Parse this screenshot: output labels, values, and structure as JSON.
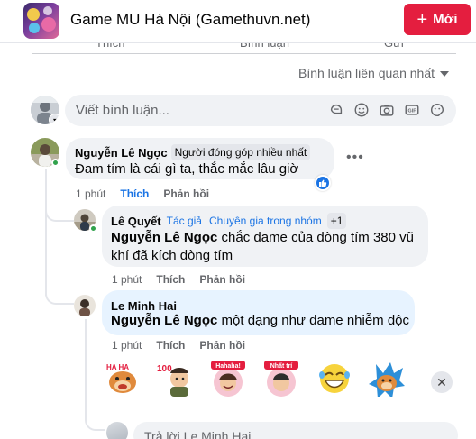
{
  "header": {
    "group_title": "Game MU Hà Nội (Gamethuvn.net)",
    "new_button_label": "Mới",
    "new_button_icon": "plus-icon",
    "accent_color": "#e41e3f"
  },
  "post_actions": {
    "like_label": "Thích",
    "comment_label": "Bình luận",
    "share_label": "Gửi"
  },
  "sort": {
    "label": "Bình luận liên quan nhất"
  },
  "composer": {
    "placeholder": "Viết bình luận...",
    "icons": [
      "avatar-sticker-icon",
      "emoji-icon",
      "camera-icon",
      "gif-icon",
      "sticker-icon"
    ]
  },
  "comments": [
    {
      "author": "Nguyễn Lê Ngọc",
      "badge": "Người đóng góp nhiều nhất",
      "text": "Đam tím là cái gì ta, thắc mắc lâu giờ",
      "time": "1 phút",
      "like_label": "Thích",
      "reply_label": "Phản hồi",
      "reaction": "like"
    }
  ],
  "replies": [
    {
      "author": "Lê Quyết",
      "tag_author": "Tác giả",
      "tag_expert": "Chuyên gia trong nhóm",
      "extra_badges": "+1",
      "mention": "Nguyễn Lê Ngọc",
      "text": " chắc dame của dòng tím 380 vũ khí đã kích dòng tím",
      "time": "1 phút",
      "like_label": "Thích",
      "reply_label": "Phản hồi"
    },
    {
      "author": "Le Minh Hai",
      "mention": "Nguyễn Lê Ngọc",
      "text": " một dạng như dame nhiễm độc",
      "time": "1 phút",
      "like_label": "Thích",
      "reply_label": "Phản hồi"
    }
  ],
  "stickers": {
    "items": [
      {
        "name": "haha-dog-sticker",
        "label": "HA HA"
      },
      {
        "name": "hundred-man-sticker",
        "label": "100"
      },
      {
        "name": "hahaha-woman-sticker",
        "label": "Hahaha!"
      },
      {
        "name": "nhat-tri-man-sticker",
        "label": "Nhất trí"
      },
      {
        "name": "laughing-face-sticker",
        "label": ""
      },
      {
        "name": "dog-thumbs-up-sticker",
        "label": ""
      }
    ]
  },
  "reply_box": {
    "placeholder": "Trả lời Le Minh Hai"
  }
}
